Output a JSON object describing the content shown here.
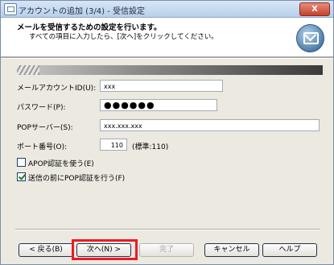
{
  "window": {
    "title": "アカウントの追加 (3/4) - 受信設定",
    "close_label": "X"
  },
  "header": {
    "title": "メールを受信するための設定を行います。",
    "subtitle": "すべての項目に入力したら、[次へ]をクリックしてください。"
  },
  "form": {
    "account_id": {
      "label": "メールアカウントID(U):",
      "value": "xxx"
    },
    "password": {
      "label": "パスワード(P):",
      "value": "●●●●●●"
    },
    "pop_server": {
      "label": "POPサーバー(S):",
      "value": "xxx.xxx.xxx"
    },
    "port": {
      "label": "ポート番号(O):",
      "value": "110",
      "default_note": "(標準:110)"
    },
    "apop": {
      "label": "APOP認証を使う(E)",
      "checked": false
    },
    "pop_before_send": {
      "label": "送信の前にPOP認証を行う(F)",
      "checked": true
    }
  },
  "buttons": {
    "back": "< 戻る(B)",
    "next": "次へ(N) >",
    "finish": "完了",
    "cancel": "キャンセル",
    "help": "ヘルプ"
  },
  "colors": {
    "highlight": "#ec1a24",
    "dialog_bg": "#ebe9e0"
  }
}
